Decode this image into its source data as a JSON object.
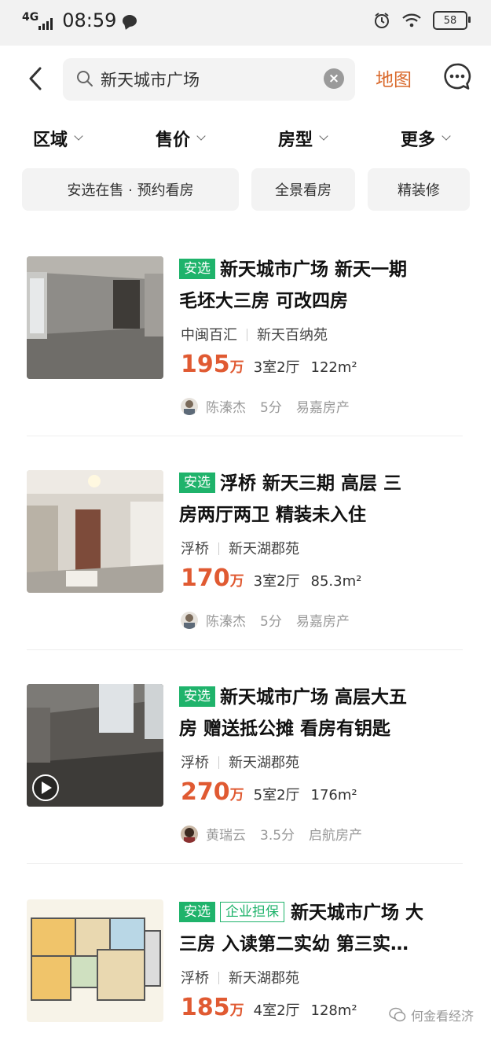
{
  "status": {
    "network": "4G",
    "time": "08:59",
    "battery": "58"
  },
  "nav": {
    "search_value": "新天城市广场",
    "map_label": "地图"
  },
  "filters": [
    {
      "label": "区域"
    },
    {
      "label": "售价"
    },
    {
      "label": "房型"
    },
    {
      "label": "更多"
    }
  ],
  "chips": [
    {
      "label": "安选在售 · 预约看房"
    },
    {
      "label": "全景看房"
    },
    {
      "label": "精装修"
    }
  ],
  "listings": [
    {
      "tags": [
        "安选"
      ],
      "title_line1": "新天城市广场 新天一期",
      "title_line2": "毛坯大三房 可改四房",
      "area": "中闽百汇",
      "community": "新天百纳苑",
      "price": "195",
      "price_unit": "万",
      "layout": "3室2厅",
      "size": "122m²",
      "agent": "陈溱杰",
      "score": "5分",
      "agency": "易嘉房产"
    },
    {
      "tags": [
        "安选"
      ],
      "title_line1": "浮桥  新天三期  高层  三",
      "title_line2": "房两厅两卫  精装未入住",
      "area": "浮桥",
      "community": "新天湖郡苑",
      "price": "170",
      "price_unit": "万",
      "layout": "3室2厅",
      "size": "85.3m²",
      "agent": "陈溱杰",
      "score": "5分",
      "agency": "易嘉房产"
    },
    {
      "tags": [
        "安选"
      ],
      "title_line1": "新天城市广场  高层大五",
      "title_line2": "房  赠送抵公摊  看房有钥匙",
      "area": "浮桥",
      "community": "新天湖郡苑",
      "price": "270",
      "price_unit": "万",
      "layout": "5室2厅",
      "size": "176m²",
      "agent": "黄瑞云",
      "score": "3.5分",
      "agency": "启航房产"
    },
    {
      "tags": [
        "安选",
        "企业担保"
      ],
      "title_line1": "新天城市广场 大",
      "title_line2": "三房 入读第二实幼 第三实…",
      "area": "浮桥",
      "community": "新天湖郡苑",
      "price": "185",
      "price_unit": "万",
      "layout": "4室2厅",
      "size": "128m²"
    }
  ],
  "watermark": "何金看经济",
  "colors": {
    "accent": "#e05a32",
    "tag_green": "#1fb36b",
    "map_orange": "#d9682a"
  }
}
